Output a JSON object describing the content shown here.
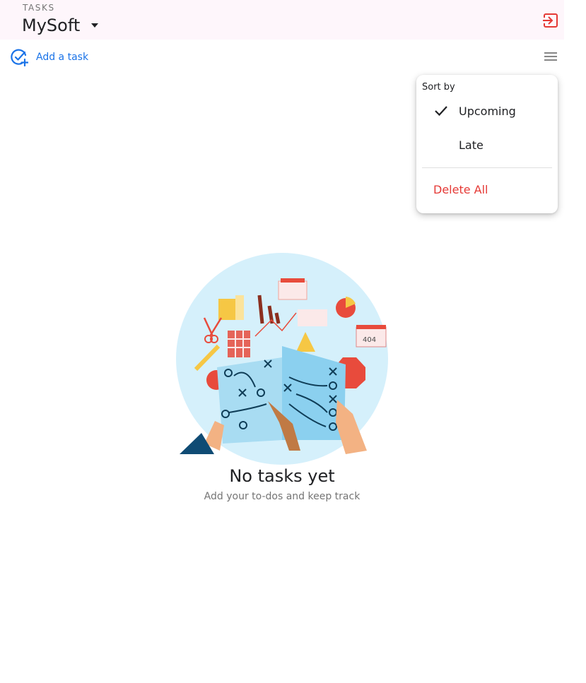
{
  "header": {
    "subtitle": "TASKS",
    "list_name": "MySoft",
    "list_selector_icon": "caret-down-icon",
    "exit_icon": "exit-icon",
    "accent_color": "#e53935",
    "background_color": "#fef6fb"
  },
  "toolbar": {
    "add_task_label": "Add a task",
    "add_task_icon": "add-task-icon",
    "menu_icon": "menu-icon",
    "accent_color": "#1a73e8"
  },
  "sort_menu": {
    "heading": "Sort by",
    "options": [
      {
        "label": "Upcoming",
        "selected": true,
        "icon": "check-icon"
      },
      {
        "label": "Late",
        "selected": false
      }
    ],
    "delete_all_label": "Delete All",
    "delete_color": "#e53935"
  },
  "empty_state": {
    "title": "No tasks yet",
    "subtitle": "Add your to-dos and keep track",
    "illustration": "planning-board-illustration"
  }
}
